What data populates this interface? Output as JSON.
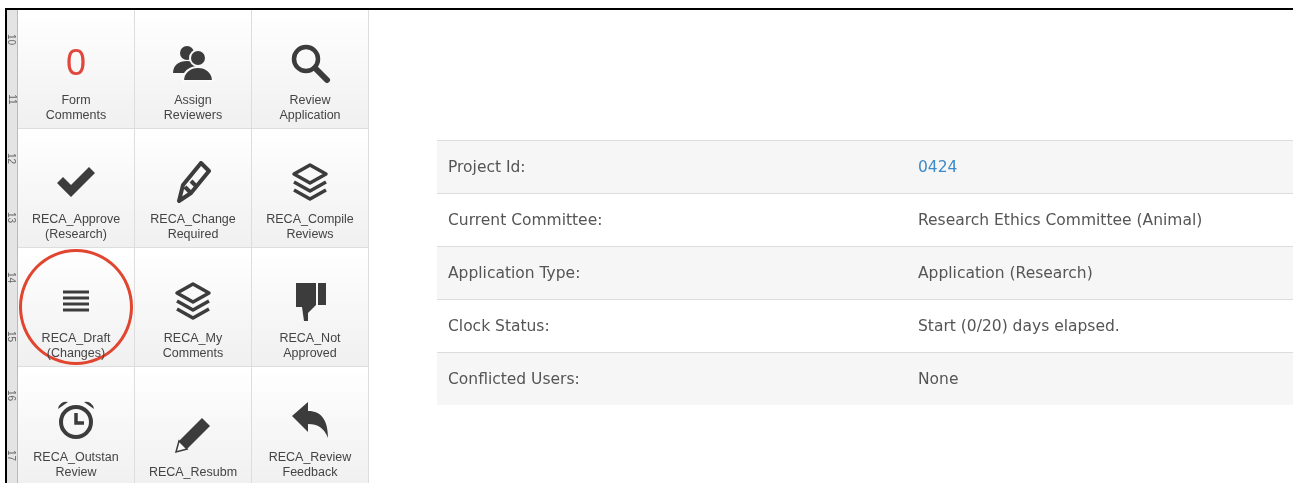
{
  "ruler": {
    "marks": [
      "10",
      "11",
      "12",
      "13",
      "14",
      "15",
      "16",
      "17"
    ]
  },
  "tiles": [
    {
      "kind": "counter",
      "count": "0",
      "lines": [
        "Form",
        "Comments"
      ],
      "highlighted": false
    },
    {
      "kind": "users",
      "lines": [
        "Assign",
        "Reviewers"
      ],
      "highlighted": false
    },
    {
      "kind": "search",
      "lines": [
        "Review",
        "Application"
      ],
      "highlighted": false
    },
    {
      "kind": "check",
      "lines": [
        "RECA_Approve",
        "(Research)"
      ],
      "highlighted": false
    },
    {
      "kind": "quill",
      "lines": [
        "RECA_Change",
        "Required"
      ],
      "highlighted": false
    },
    {
      "kind": "layers",
      "lines": [
        "RECA_Compile",
        "Reviews"
      ],
      "highlighted": false
    },
    {
      "kind": "list",
      "lines": [
        "RECA_Draft",
        "(Changes)"
      ],
      "highlighted": true
    },
    {
      "kind": "layers",
      "lines": [
        "RECA_My",
        "Comments"
      ],
      "highlighted": false
    },
    {
      "kind": "thumbs-down",
      "lines": [
        "RECA_Not",
        "Approved"
      ],
      "highlighted": false
    },
    {
      "kind": "alarm",
      "lines": [
        "RECA_Outstan",
        "Review"
      ],
      "highlighted": false
    },
    {
      "kind": "pencil",
      "lines": [
        "RECA_Resubm"
      ],
      "highlighted": false
    },
    {
      "kind": "reply",
      "lines": [
        "RECA_Review",
        "Feedback"
      ],
      "highlighted": false
    }
  ],
  "details": [
    {
      "label": "Project Id:",
      "value": "0424",
      "link": true
    },
    {
      "label": "Current Committee:",
      "value": "Research Ethics Committee (Animal)",
      "link": false
    },
    {
      "label": "Application Type:",
      "value": "Application (Research)",
      "link": false
    },
    {
      "label": "Clock Status:",
      "value": "Start (0/20) days elapsed.",
      "link": false
    },
    {
      "label": "Conflicted Users:",
      "value": "None",
      "link": false
    }
  ]
}
